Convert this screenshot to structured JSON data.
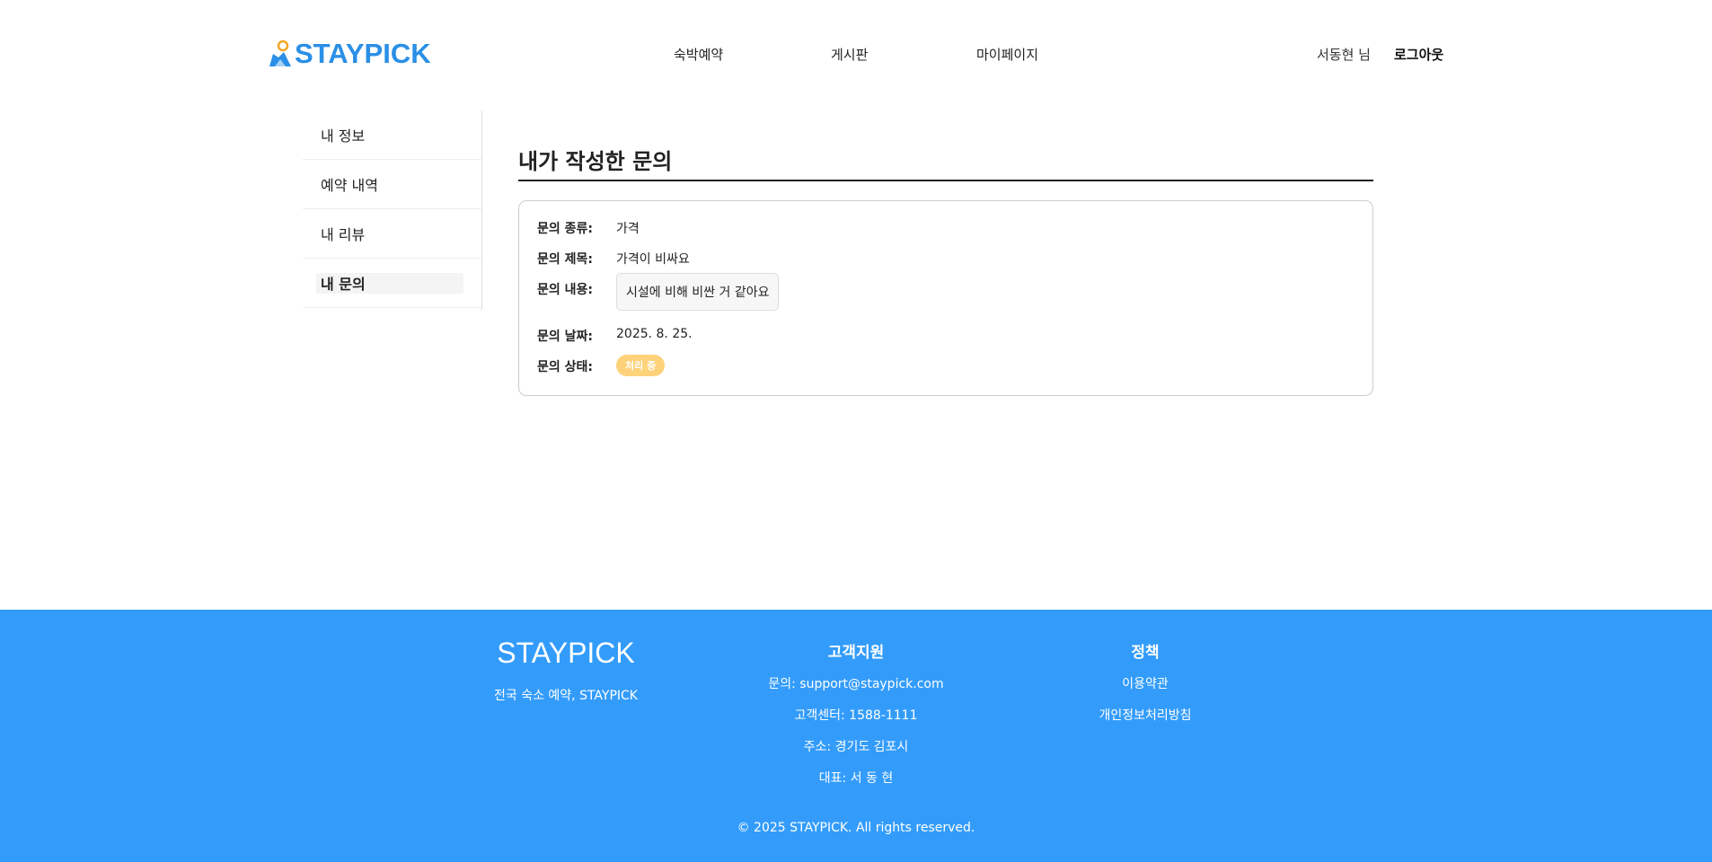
{
  "header": {
    "logo_text": "STAYPICK",
    "nav": [
      "숙박예약",
      "게시판",
      "마이페이지"
    ],
    "user_name": "서동현 님",
    "logout": "로그아웃"
  },
  "sidebar": {
    "items": [
      "내 정보",
      "예약 내역",
      "내 리뷰",
      "내 문의"
    ],
    "active": "내 문의"
  },
  "main": {
    "title": "내가 작성한 문의",
    "inquiry": {
      "type_label": "문의 종류:",
      "type_value": "가격",
      "subject_label": "문의 제목:",
      "subject_value": "가격이 비싸요",
      "content_label": "문의 내용:",
      "content_value": "시설에 비해 비싼 거 같아요",
      "date_label": "문의 날짜:",
      "date_value": "2025. 8. 25.",
      "status_label": "문의 상태:",
      "status_value": "처리 중"
    }
  },
  "footer": {
    "brand": "STAYPICK",
    "tagline": "전국 숙소 예약, STAYPICK",
    "support_heading": "고객지원",
    "support_lines": [
      "문의: support@staypick.com",
      "고객센터: 1588-1111",
      "주소: 경기도 김포시",
      "대표: 서 동 현"
    ],
    "policy_heading": "정책",
    "policy_links": [
      "이용약관",
      "개인정보처리방침"
    ],
    "copyright": "© 2025 STAYPICK. All rights reserved."
  },
  "colors": {
    "brand": "#2a8fe6",
    "footer_bg": "#339cfb",
    "status_badge": "#fdd27a"
  }
}
